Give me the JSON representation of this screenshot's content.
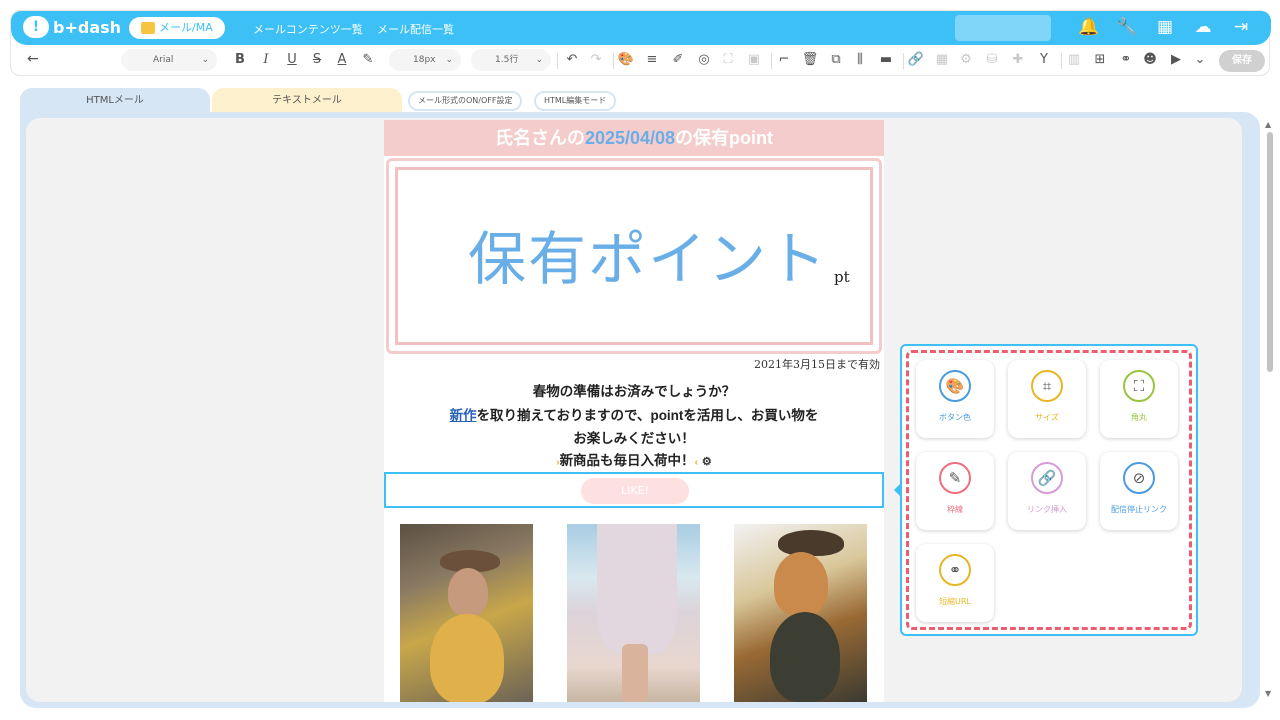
{
  "app": {
    "logo": "b+dash",
    "logo_badge": "!"
  },
  "nav": {
    "active_pill": "メール/MA",
    "links": [
      "メールコンテンツ一覧",
      "メール配信一覧"
    ],
    "icons": [
      "bell-icon",
      "wrench-icon",
      "grid-icon",
      "help-icon",
      "logout-icon"
    ]
  },
  "toolbar": {
    "font_family": "Arial",
    "font_size": "18px",
    "line_height": "1.5行",
    "save_label": "保存"
  },
  "tabs": {
    "html_mail": "HTMLメール",
    "text_mail": "テキストメール"
  },
  "options": {
    "mail_format": "メール形式のON/OFF設定",
    "html_edit": "HTML編集モード"
  },
  "mail": {
    "header_prefix": "氏名さんの",
    "header_date": "2025/04/08",
    "header_suffix": "の保有point",
    "big_title": "保有ポイント",
    "unit": "pt",
    "valid_until": "2021年3月15日まで有効",
    "line1": "春物の準備はお済みでしょうか？",
    "line2_link": "新作",
    "line2_rest": "を取り揃えておりますので、pointを活用し、お買い物を",
    "line3": "お楽しみください！",
    "line4": "新商品も毎日入荷中！",
    "like_button": "LIKE!"
  },
  "panel": {
    "items": [
      {
        "label": "ボタン色",
        "color": "#4a9be0",
        "icon": "palette-icon"
      },
      {
        "label": "サイズ",
        "color": "#e8b624",
        "icon": "crop-icon"
      },
      {
        "label": "角丸",
        "color": "#9bc43e",
        "icon": "expand-icon"
      },
      {
        "label": "枠線",
        "color": "#ec6f7d",
        "icon": "pen-icon"
      },
      {
        "label": "リンク挿入",
        "color": "#d79bd8",
        "icon": "link-icon"
      },
      {
        "label": "配信停止リンク",
        "color": "#4a9be0",
        "icon": "unsubscribe-link-icon"
      },
      {
        "label": "短縮URL",
        "color": "#e8b624",
        "icon": "short-url-icon"
      }
    ]
  }
}
